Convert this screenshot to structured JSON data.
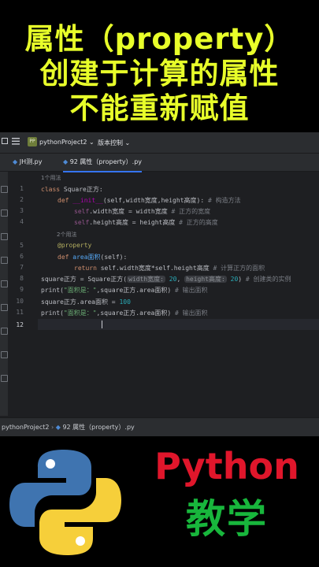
{
  "banner": {
    "line1": "属性（property）",
    "line2": "创建于计算的属性",
    "line3": "不能重新赋值"
  },
  "ide": {
    "project_name": "pythonProject2",
    "project_badge": "PP",
    "vcs_label": "版本控制",
    "tabs": [
      {
        "label": "JH测.py"
      },
      {
        "label": "92 属性（property）.py"
      }
    ],
    "usage_hints": [
      "1个用法",
      "2个用法"
    ],
    "line_numbers": [
      "1",
      "2",
      "3",
      "4",
      "5",
      "6",
      "7",
      "8",
      "9",
      "10",
      "11",
      "12"
    ],
    "code": {
      "l1_kw": "class",
      "l1_name": "Square正方:",
      "l2_kw": "def",
      "l2_magic": "__init__",
      "l2_rest": "(self,width宽度,height高度):",
      "l2_cm": "# 构造方法",
      "l3_self": "self",
      "l3_rest": ".width宽度 = width宽度",
      "l3_cm": "# 正方的宽度",
      "l4_self": "self",
      "l4_rest": ".height高度 = height高度",
      "l4_cm": "# 正方的高度",
      "l5_deco": "@property",
      "l6_kw": "def",
      "l6_fn": "area面积",
      "l6_rest": "(self):",
      "l7_kw": "return",
      "l7_rest": "self.width宽度*self.height高度",
      "l7_cm": "# 计算正方的面积",
      "l8_a": "square正方 = Square正方(",
      "l8_p1": "width宽度:",
      "l8_v1": "20",
      "l8_p2": "height高度:",
      "l8_v2": "20",
      "l8_b": ")",
      "l8_cm": "# 创建类的实例",
      "l9_a": "print(",
      "l9_str": "\"面积是：\"",
      "l9_b": ",square正方.area面积)",
      "l9_cm": "# 输出面积",
      "l10_a": "square正方.area面积 = ",
      "l10_num": "100",
      "l11_a": "print(",
      "l11_str": "\"面积是：\"",
      "l11_b": ",square正方.area面积)",
      "l11_cm": "# 输出面积"
    },
    "breadcrumb": {
      "project": "pythonProject2",
      "file": "92 属性（property）.py"
    }
  },
  "footer": {
    "python_label": "Python",
    "edu_label": "教学"
  }
}
